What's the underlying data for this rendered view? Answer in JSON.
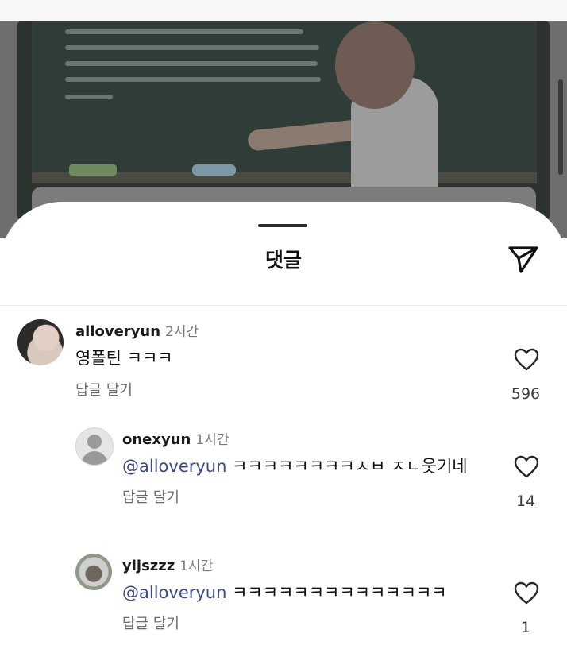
{
  "sheet": {
    "title": "댓글"
  },
  "icons": {
    "share": "paper-plane-icon",
    "like": "heart-outline-icon",
    "avatar_placeholder": "default-user-icon"
  },
  "colors": {
    "mention": "#3b4a86",
    "secondary_text": "#6b6b6b"
  },
  "comments": [
    {
      "username": "alloveryun",
      "time": "2시간",
      "mention": "",
      "text": "영폴틴 ㅋㅋㅋ",
      "reply_label": "답글 달기",
      "likes": "596"
    },
    {
      "username": "onexyun",
      "time": "1시간",
      "mention": "@alloveryun",
      "text": "ㅋㅋㅋㅋㅋㅋㅋㅋㅅㅂ ㅈㄴ웃기네",
      "reply_label": "답글 달기",
      "likes": "14"
    },
    {
      "username": "yijszzz",
      "time": "1시간",
      "mention": "@alloveryun",
      "text": "ㅋㅋㅋㅋㅋㅋㅋㅋㅋㅋㅋㅋㅋㅋ",
      "reply_label": "답글 달기",
      "likes": "1"
    }
  ]
}
